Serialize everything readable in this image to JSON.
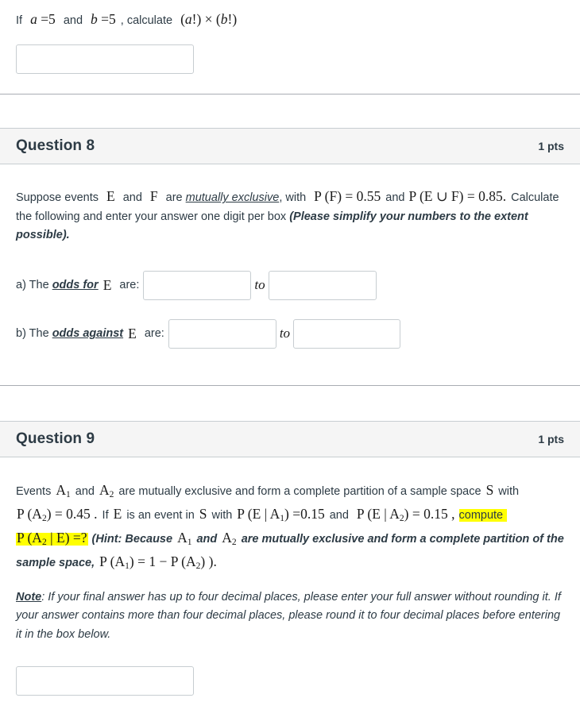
{
  "quiz": {
    "q7_tail": {
      "name": "question-7-tail",
      "prompt_if": "If",
      "prompt_a": "a =5",
      "prompt_and": "and",
      "prompt_b": "b =5",
      "prompt_calc": ", calculate",
      "prompt_expr": "(a!) × (b!)",
      "answer_value": "",
      "answer_placeholder": ""
    },
    "questions": [
      {
        "id": "question-8",
        "title": "Question 8",
        "points": "1 pts",
        "stem": {
          "p1_a": "Suppose events",
          "p1_E": "E",
          "p1_and": "and",
          "p1_F": "F",
          "p1_are": "are",
          "p1_mutually": "mutually exclusive",
          "p1_comma_with": ", with",
          "p1_PF": "P (F) = 0.55",
          "p1_and2": "and",
          "p2_PEuF": "P (E ∪ F) = 0.85.",
          "p2_text": "Calculate the following and enter your answer one digit per box",
          "p2_emph": "(Please simplify your numbers to the extent possible)."
        },
        "parts": [
          {
            "label_prefix": "a) The",
            "label_emph": "odds for",
            "label_var": "E",
            "label_suffix": "are:",
            "box1_value": "",
            "box1_placeholder": "",
            "separator": "to",
            "box2_value": "",
            "box2_placeholder": ""
          },
          {
            "label_prefix": "b) The",
            "label_emph": "odds against",
            "label_var": "E",
            "label_suffix": "are:",
            "box1_value": "",
            "box1_placeholder": "",
            "separator": "to",
            "box2_value": "",
            "box2_placeholder": ""
          }
        ]
      },
      {
        "id": "question-9",
        "title": "Question 9",
        "points": "1 pts",
        "stem": {
          "l1_a": "Events",
          "l1_A1": "A₁",
          "l1_and": "and",
          "l1_A2": "A₂",
          "l1_b": "are mutually exclusive and form a complete partition of a sample space",
          "l1_S": "S",
          "l1_with": "with",
          "l2_PA2": "P (A₂) = 0.45 .",
          "l2_if": "If",
          "l2_E": "E",
          "l2_isan": "is an event in",
          "l2_S": "S",
          "l2_with": "with",
          "l2_PEA1": "P (E | A₁) =0.15",
          "l2_and": "and",
          "l2_PEA2": "P (E | A₂) = 0.15 ,",
          "l3_compute": "compute",
          "l3_expr": "P (A₂ | E) =?",
          "l3_hint_open": "(Hint: Because",
          "l3_A1": "A₁",
          "l3_and": "and",
          "l3_A2": "A₂",
          "l3_hint_rest": "are mutually exclusive and form a complete partition of the sample space,",
          "l3_hint_eq": "P (A₁) = 1 − P (A₂) ).",
          "note_label": "Note",
          "note_text": ": If your final answer has up to four decimal places, please enter your full answer without rounding it. If your answer contains more than four decimal places, please round it to four decimal places before entering it in the box below."
        },
        "answer_value": "",
        "answer_placeholder": ""
      }
    ]
  },
  "colors": {
    "header_bg": "#f5f5f5",
    "text": "#2d3b45",
    "border": "#c7cdd1",
    "divider": "#a8adb3",
    "highlight": "#ffff00"
  }
}
